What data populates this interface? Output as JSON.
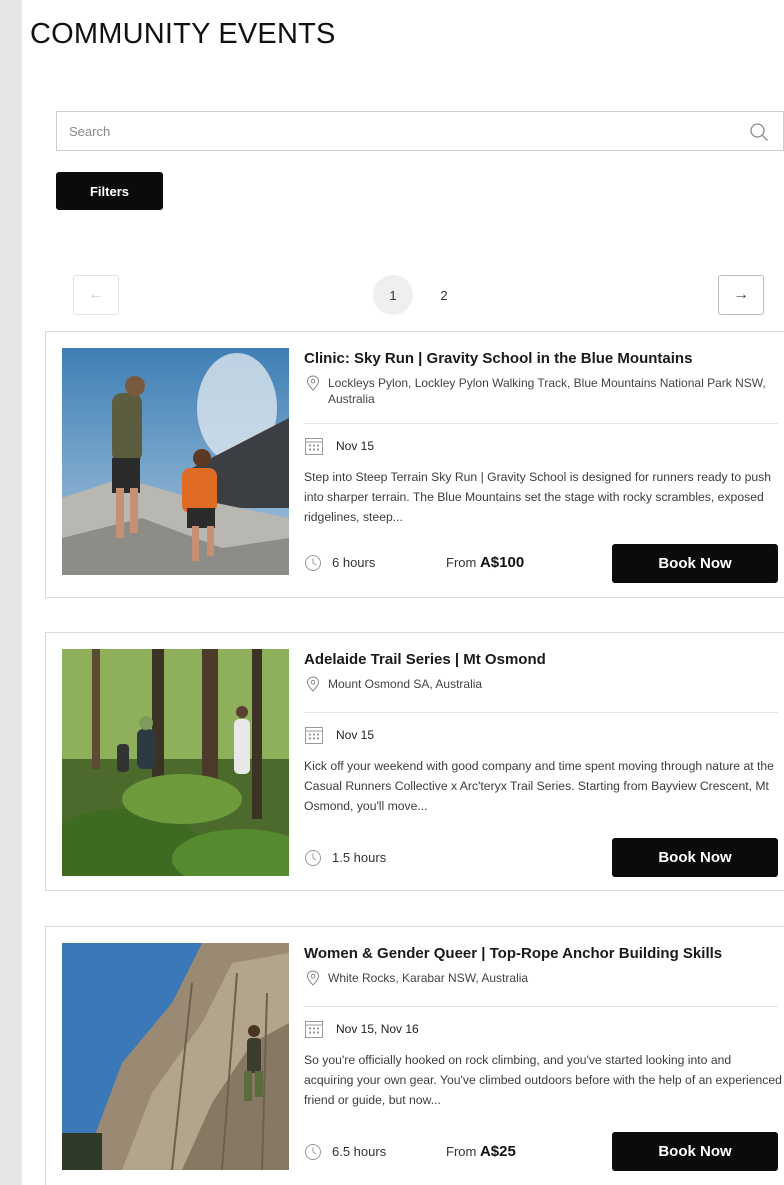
{
  "page": {
    "title": "COMMUNITY EVENTS"
  },
  "search": {
    "placeholder": "Search",
    "icon": "search-icon"
  },
  "filters": {
    "label": "Filters"
  },
  "pagination": {
    "prev": "←",
    "next": "→",
    "pages": [
      "1",
      "2"
    ],
    "current": "1"
  },
  "colors": {
    "accent": "#0b0b0b",
    "border": "#d9d9d9"
  },
  "events": [
    {
      "title": "Clinic: Sky Run | Gravity School in the Blue Mountains",
      "location": "Lockleys Pylon, Lockley Pylon Walking Track, Blue Mountains National Park NSW, Australia",
      "date": "Nov 15",
      "description": "Step into Steep Terrain Sky Run | Gravity School is designed for runners ready to push into sharper terrain. The Blue Mountains set the stage with rocky scrambles, exposed ridgelines, steep...",
      "duration": "6 hours",
      "price_prefix": "From",
      "price": "A$100",
      "cta": "Book Now"
    },
    {
      "title": "Adelaide Trail Series | Mt Osmond",
      "location": "Mount Osmond SA, Australia",
      "date": "Nov 15",
      "description": "Kick off your weekend with good company and time spent moving through nature at the Casual Runners Collective  x Arc'teryx Trail Series. Starting from Bayview Crescent, Mt Osmond, you'll move...",
      "duration": "1.5 hours",
      "cta": "Book Now"
    },
    {
      "title": "Women & Gender Queer | Top-Rope Anchor Building Skills",
      "location": "White Rocks, Karabar NSW, Australia",
      "date": "Nov 15, Nov 16",
      "description": "So you're officially hooked on rock climbing, and you've started looking into and acquiring your own gear. You've climbed outdoors before with the help of an experienced friend or guide, but now...",
      "duration": "6.5 hours",
      "price_prefix": "From",
      "price": "A$25",
      "cta": "Book Now"
    }
  ]
}
